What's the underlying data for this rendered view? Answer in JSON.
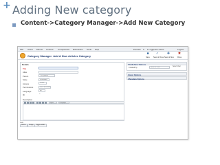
{
  "slide": {
    "plus": "+",
    "title": "Adding New category",
    "bullet": "Content->Category Manager->Add New Category"
  },
  "screenshot": {
    "menu": {
      "items": [
        "Site",
        "Users",
        "Menus",
        "Content",
        "Components",
        "Extensions",
        "Tools",
        "Help"
      ],
      "status": [
        "Preview",
        "0",
        "1 Logged-in Users",
        "Logout"
      ]
    },
    "page_title": "Category Manager: Add A New Articles Category",
    "toolbar": [
      "Save",
      "Save & Close",
      "Save & New",
      "Close"
    ],
    "details": {
      "legend": "Details",
      "fields": [
        {
          "label": "Title",
          "required": true,
          "value": ""
        },
        {
          "label": "Alias",
          "required": false,
          "value": ""
        },
        {
          "label": "Parent",
          "required": false,
          "value": "- No parent -"
        },
        {
          "label": "State",
          "required": false,
          "value": "Published"
        },
        {
          "label": "Access",
          "required": false,
          "value": "Public"
        },
        {
          "label": "Permissions",
          "required": false,
          "value": "Set Permissions"
        },
        {
          "label": "Language",
          "required": false,
          "value": "All"
        },
        {
          "label": "ID",
          "required": false,
          "value": "0"
        }
      ],
      "description_label": "Description",
      "styles_select": "Styles",
      "paragraph_select": "Paragraph"
    },
    "editor_footer": {
      "path": "Path:",
      "buttons": [
        "Article",
        "Image",
        "Toggle editor"
      ]
    },
    "sidebar": {
      "publishing": {
        "title": "Publishing Options",
        "created_by_label": "Created by",
        "created_by_value": "Select a User",
        "select_user_button": "Select User"
      },
      "basic": "Basic Options",
      "metadata": "Metadata Options"
    }
  }
}
